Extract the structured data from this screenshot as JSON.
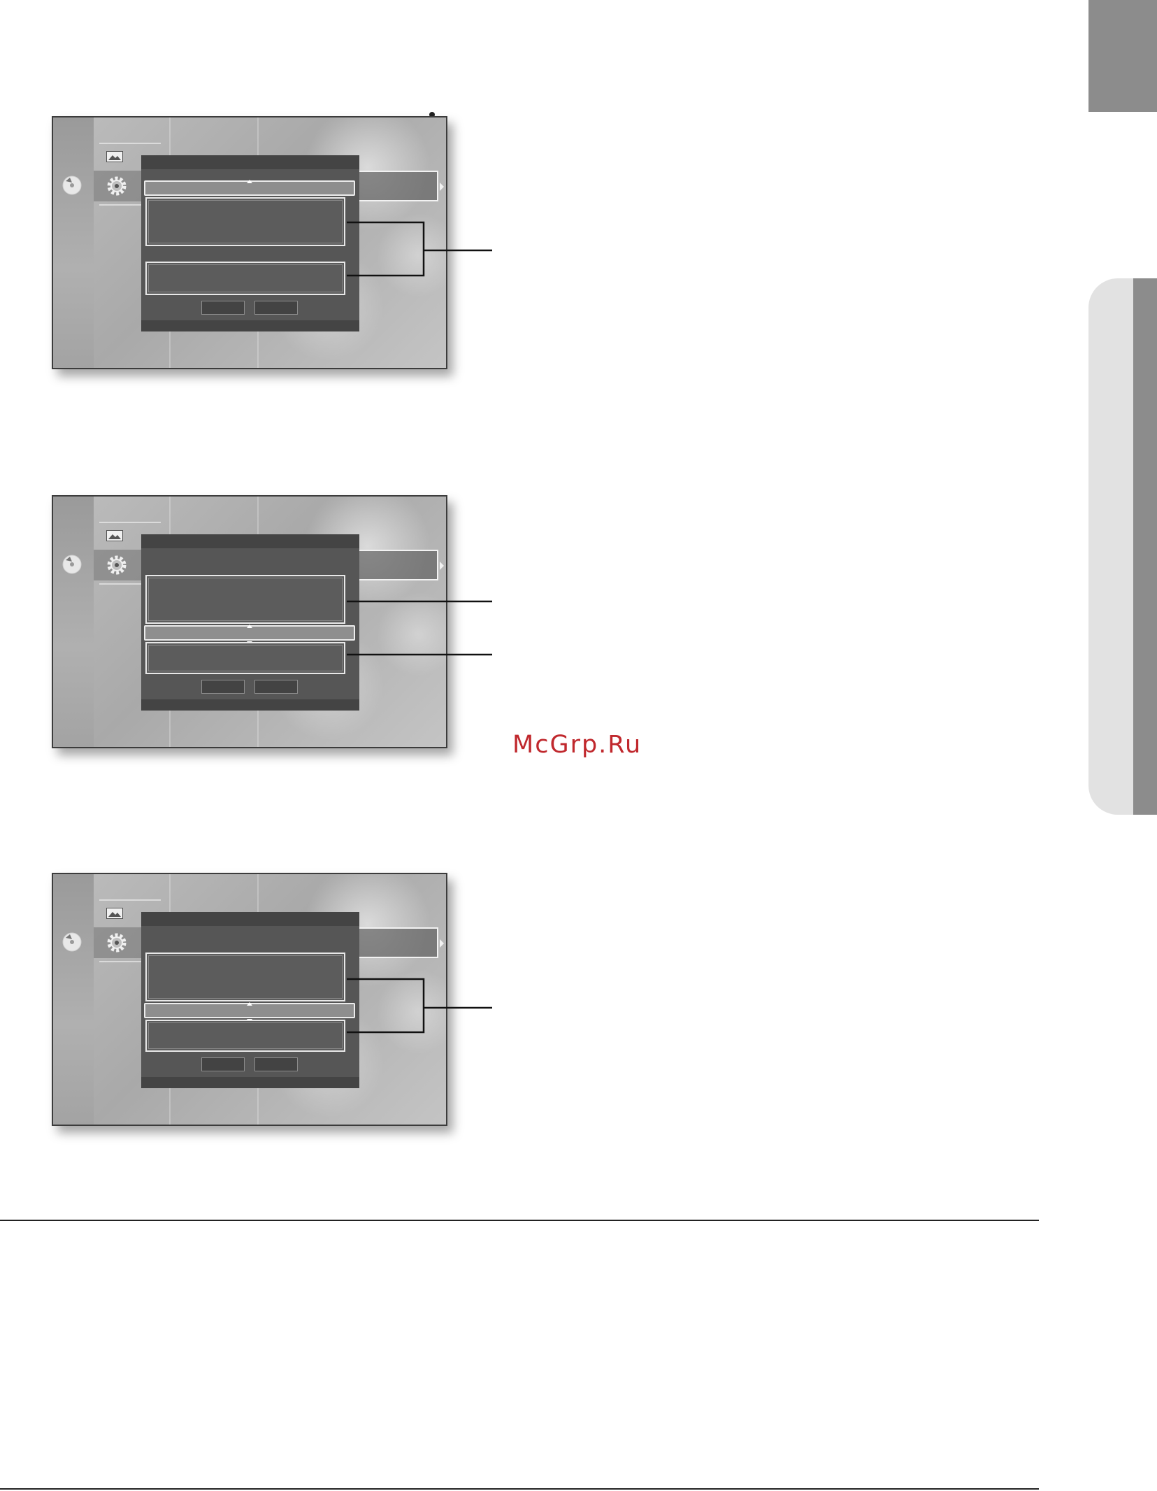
{
  "watermark": {
    "text": "McGrp.Ru",
    "color": "#c0282d"
  },
  "tabs": {
    "accent_color": "#8c8c8c",
    "light_color": "#e2e2e2"
  },
  "screenshots": [
    {
      "id": "screen-1",
      "selected_field": "top",
      "callout_style": "bracket"
    },
    {
      "id": "screen-2",
      "selected_field": "middle",
      "callout_style": "two-lines"
    },
    {
      "id": "screen-3",
      "selected_field": "middle",
      "callout_style": "bracket"
    }
  ],
  "icons": [
    "disc-icon",
    "photo-icon",
    "gear-icon",
    "caret-right-icon",
    "arrow-up-icon",
    "arrow-down-icon"
  ]
}
